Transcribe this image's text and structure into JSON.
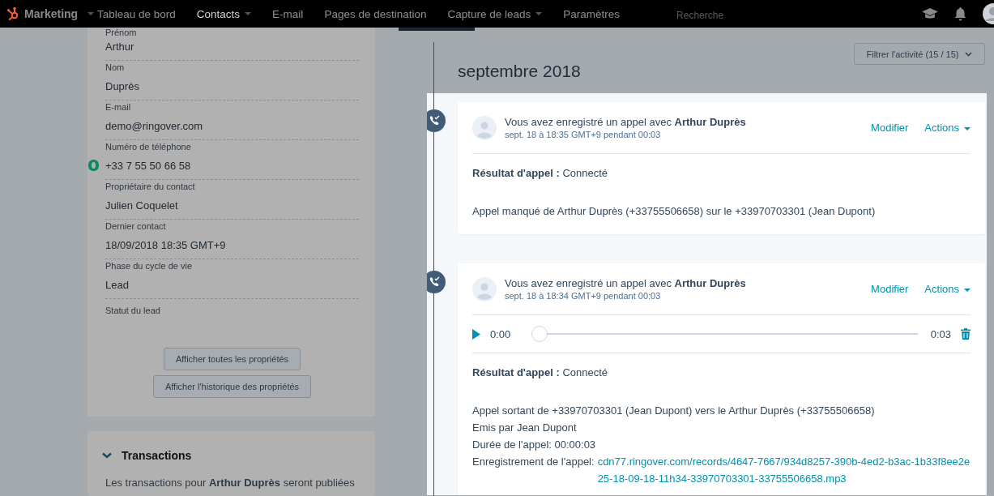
{
  "nav": {
    "brand": "Marketing",
    "items": [
      {
        "label": "Tableau de bord",
        "caret": false,
        "selected": false
      },
      {
        "label": "Contacts",
        "caret": true,
        "selected": true
      },
      {
        "label": "E-mail",
        "caret": false,
        "selected": false
      },
      {
        "label": "Pages de destination",
        "caret": false,
        "selected": false
      },
      {
        "label": "Capture de leads",
        "caret": true,
        "selected": false
      },
      {
        "label": "Paramètres",
        "caret": false,
        "selected": false
      }
    ],
    "search": {
      "placeholder": "Recherche"
    }
  },
  "properties": [
    {
      "label": "Prénom",
      "value": "Arthur"
    },
    {
      "label": "Nom",
      "value": "Duprès"
    },
    {
      "label": "E-mail",
      "value": "demo@ringover.com"
    },
    {
      "label": "Numéro de téléphone",
      "value": "+33 7 55 50 66 58",
      "kind": "phone"
    },
    {
      "label": "Propriétaire du contact",
      "value": "Julien Coquelet"
    },
    {
      "label": "Dernier contact",
      "value": "18/09/2018 18:35 GMT+9"
    },
    {
      "label": "Phase du cycle de vie",
      "value": "Lead"
    },
    {
      "label": "Statut du lead"
    }
  ],
  "property_buttons": [
    "Afficher toutes les propriétés",
    "Afficher l'historique des propriétés"
  ],
  "transactions": {
    "title": "Transactions",
    "expanded": true,
    "text": "Les transactions pour **Arthur Duprès** seront publiées"
  },
  "timeline": {
    "filter": "Filtrer l'activité (15 / 15)",
    "month": "septembre 2018",
    "events": [
      {
        "title": "Vous avez enregistré un appel avec **Arthur Duprès**",
        "meta": "sept. 18 à 18:35 GMT+9 pendant 00:03",
        "edit": "Modifier",
        "actions": "Actions",
        "result_label": "Résultat d'appel :",
        "result": "Connecté",
        "lines": [
          {
            "text": "Appel manqué de Arthur Duprès (+33755506658) sur le +33970703301 (Jean Dupont)"
          }
        ]
      },
      {
        "title": "Vous avez enregistré un appel avec **Arthur Duprès**",
        "meta": "sept. 18 à 18:34 GMT+9 pendant 00:03",
        "edit": "Modifier",
        "actions": "Actions",
        "recording": {
          "start": "0:00",
          "end": "0:03",
          "level": 0
        },
        "result_label": "Résultat d'appel :",
        "result": "Connecté",
        "lines": [
          {
            "text": "Appel sortant de +33970703301 (Jean Dupont) vers le Arthur Duprès (+33755506658)"
          },
          {
            "text": "Emis par Jean Dupont"
          },
          {
            "text": "Durée de l'appel: 00:00:03"
          },
          {
            "text": "Enregistrement de l'appel:",
            "link": "cdn77.ringover.com/records/4647-7667/934d8257-390b-4ed2-b3ac-1b33f8ee2e25-18-09-18-11h34-33970703301-33755506658.mp3"
          }
        ]
      }
    ]
  }
}
